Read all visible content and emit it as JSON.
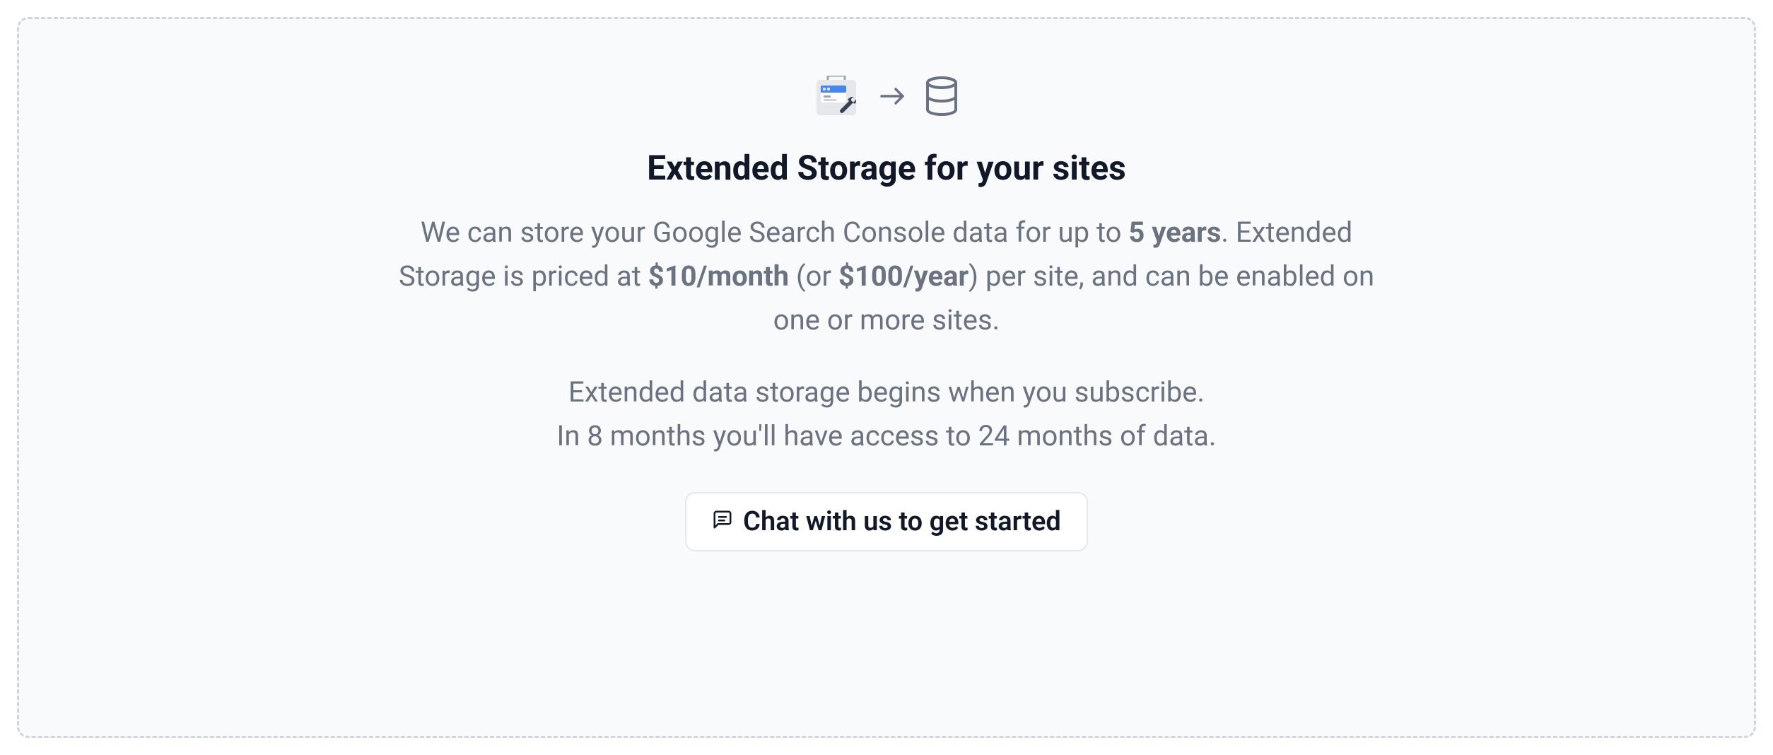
{
  "card": {
    "heading": "Extended Storage for your sites",
    "description": {
      "prefix": "We can store your Google Search Console data for up to ",
      "highlight_duration": "5 years",
      "after_duration": ". Extended Storage is priced at ",
      "price_monthly": "$10/month",
      "between_prices": " (or ",
      "price_yearly": "$100/year",
      "suffix": ") per site, and can be enabled on one or more sites."
    },
    "secondary_line1": "Extended data storage begins when you subscribe.",
    "secondary_line2": "In 8 months you'll have access to 24 months of data.",
    "button_label": "Chat with us to get started"
  }
}
